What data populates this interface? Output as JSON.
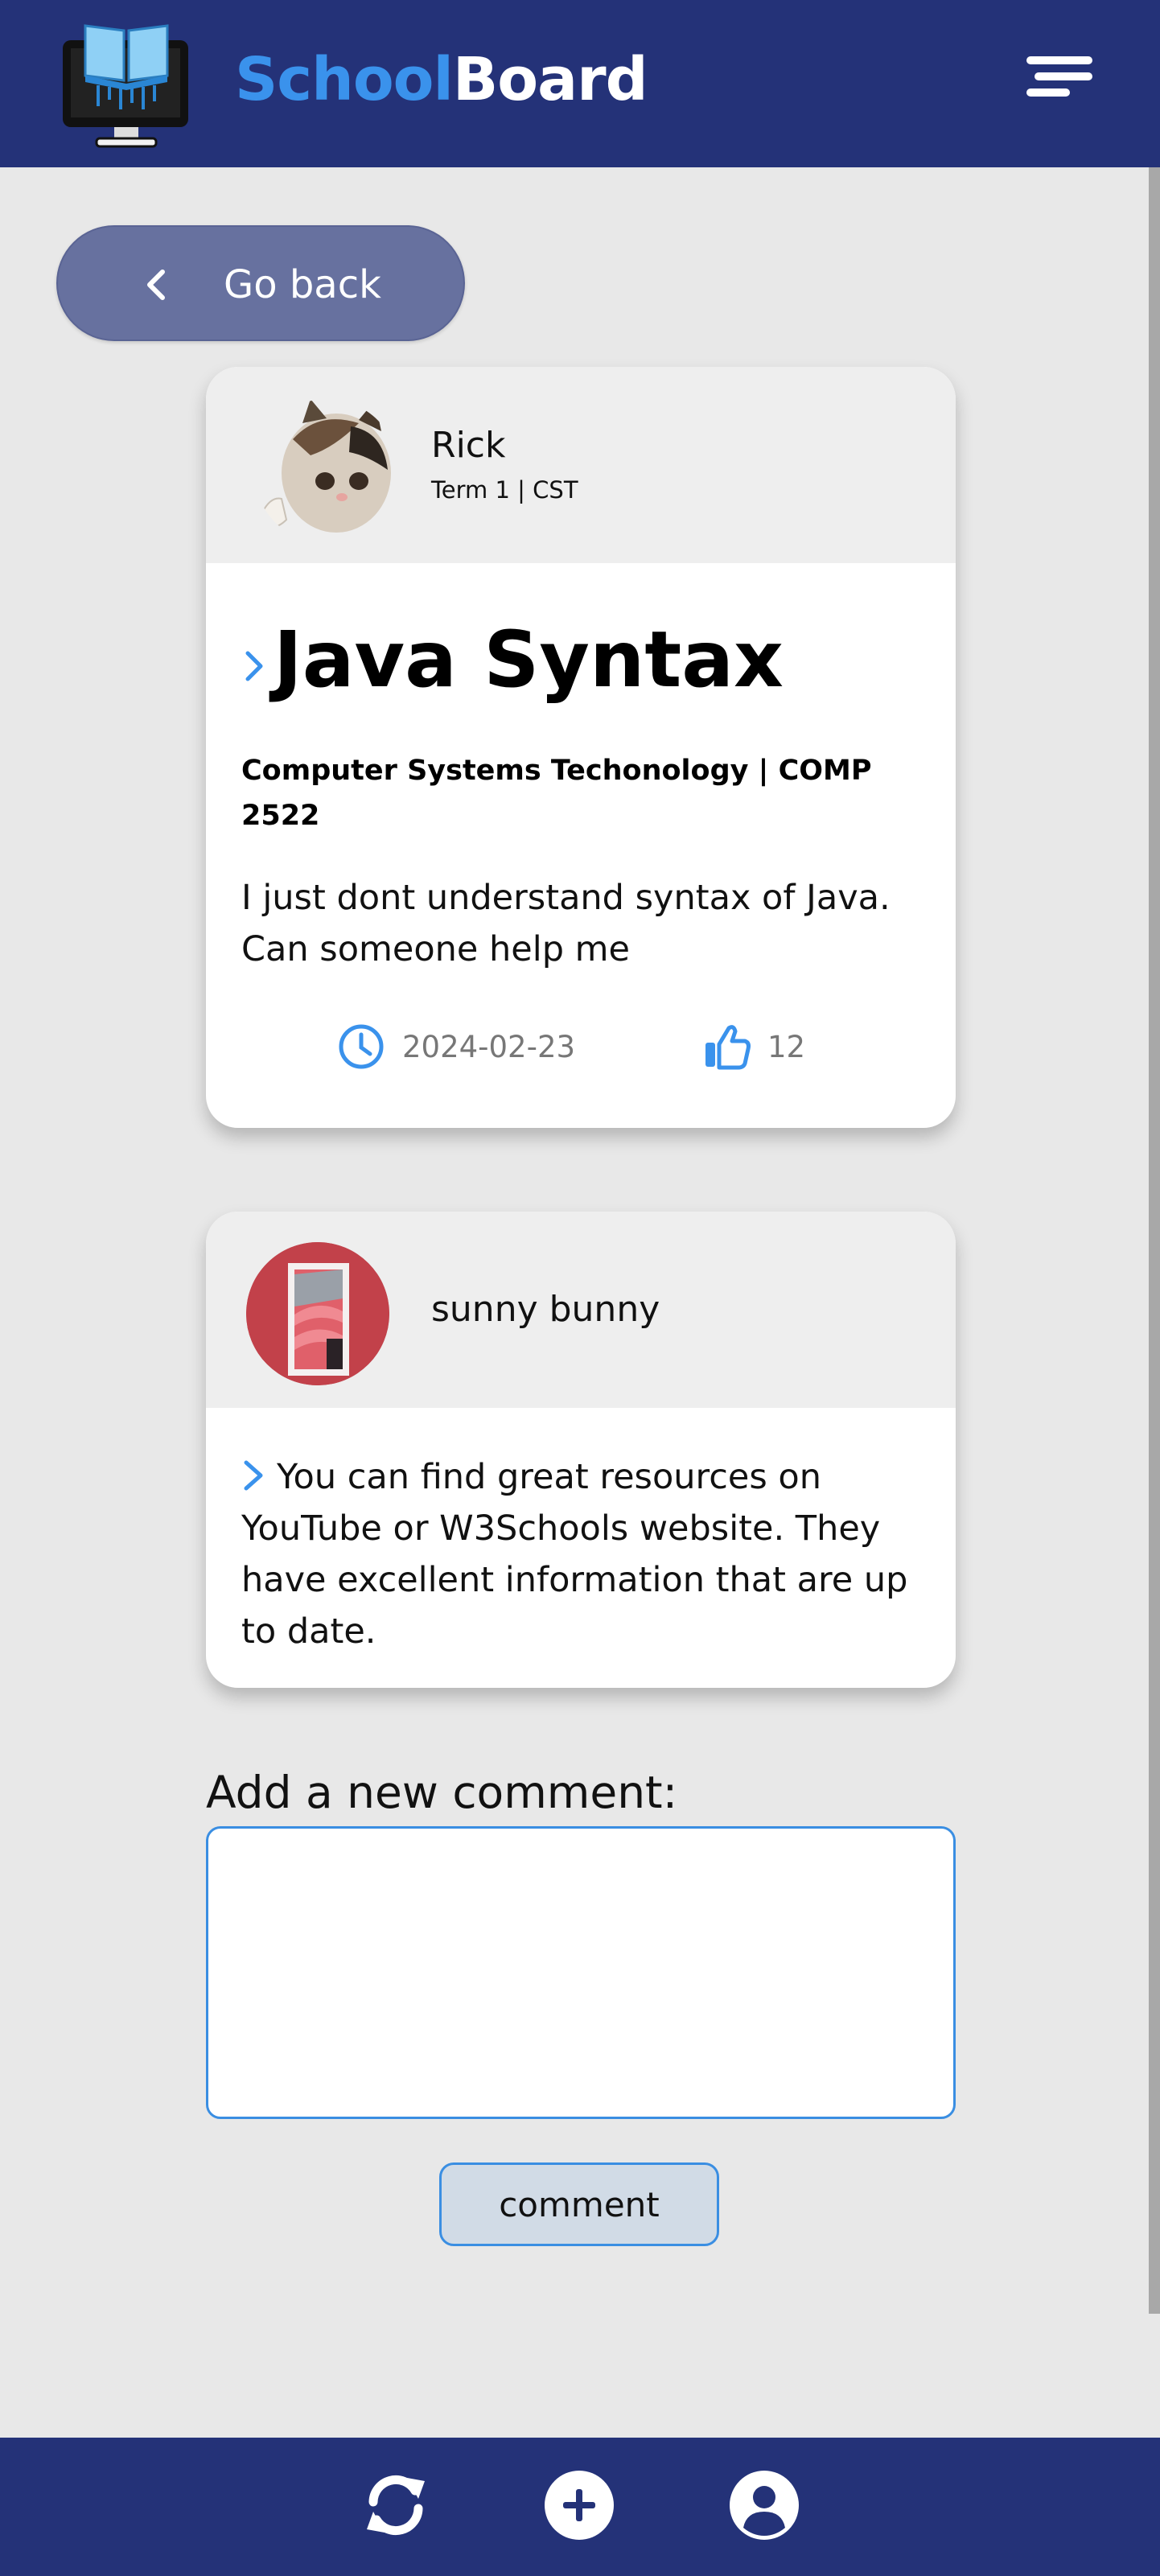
{
  "header": {
    "brand_part1": "School",
    "brand_part2": "Board",
    "logo_icon": "computer-book-icon",
    "menu_icon": "hamburger-menu-icon"
  },
  "nav": {
    "back_label": "Go back"
  },
  "post": {
    "author": "Rick",
    "author_meta": "Term 1 | CST",
    "title": "Java Syntax",
    "course": "Computer Systems Techonology | COMP 2522",
    "body": "I just dont understand syntax of Java. Can someone help me",
    "date": "2024-02-23",
    "likes": "12"
  },
  "replies": [
    {
      "author": "sunny bunny",
      "body": "You can find great resources on YouTube or W3Schools website. They have excellent information that are up to date."
    }
  ],
  "comment_form": {
    "label": "Add a new comment:",
    "placeholder": "",
    "button_label": "comment"
  },
  "bottom_nav": {
    "items": [
      "refresh-icon",
      "add-post-icon",
      "profile-icon"
    ]
  },
  "colors": {
    "header_bg": "#243278",
    "accent": "#3a92ec",
    "page_bg": "#e8e8e8",
    "back_button": "#67719f"
  }
}
